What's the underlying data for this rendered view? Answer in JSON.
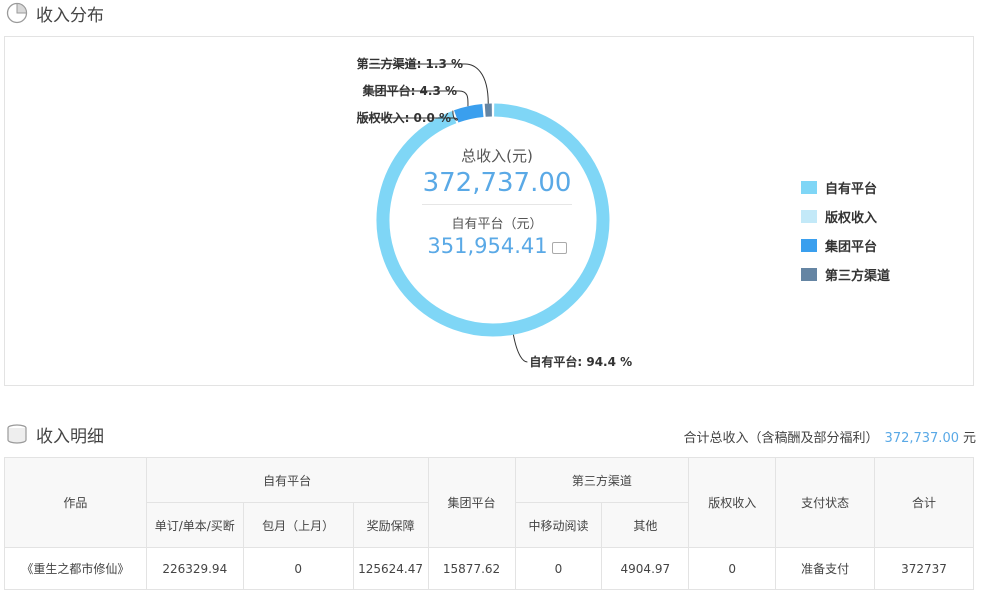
{
  "section1": {
    "title": "收入分布"
  },
  "center": {
    "total_label": "总收入(元)",
    "total_value": "372,737.00",
    "sub_label": "自有平台（元）",
    "sub_value": "351,954.41"
  },
  "chart_data": {
    "type": "pie",
    "series": [
      {
        "name": "自有平台",
        "value": 94.4,
        "color": "#7fd6f6",
        "label": "自有平台: 94.4 %"
      },
      {
        "name": "版权收入",
        "value": 0.0,
        "color": "#c3e9f8",
        "label": "版权收入: 0.0 %"
      },
      {
        "name": "集团平台",
        "value": 4.3,
        "color": "#3a9fee",
        "label": "集团平台: 4.3 %"
      },
      {
        "name": "第三方渠道",
        "value": 1.3,
        "color": "#6585a3",
        "label": "第三方渠道: 1.3 %"
      }
    ],
    "legend_position": "right"
  },
  "section2": {
    "title": "收入明细"
  },
  "summary": {
    "label": "合计总收入（含稿酬及部分福利）",
    "amount": "372,737.00",
    "unit": "元"
  },
  "table": {
    "headers": {
      "work": "作品",
      "self_platform": "自有平台",
      "group_platform": "集团平台",
      "third_party": "第三方渠道",
      "copyright": "版权收入",
      "pay_status": "支付状态",
      "total": "合计",
      "sub": {
        "single": "单订/单本/买断",
        "monthly": "包月（上月）",
        "reward": "奖励保障",
        "cmread": "中移动阅读",
        "other": "其他"
      }
    },
    "rows": [
      {
        "work": "《重生之都市修仙》",
        "single": "226329.94",
        "monthly": "0",
        "reward": "125624.47",
        "group": "15877.62",
        "cmread": "0",
        "other": "4904.97",
        "copyright": "0",
        "pay_status": "准备支付",
        "total": "372737"
      }
    ]
  }
}
